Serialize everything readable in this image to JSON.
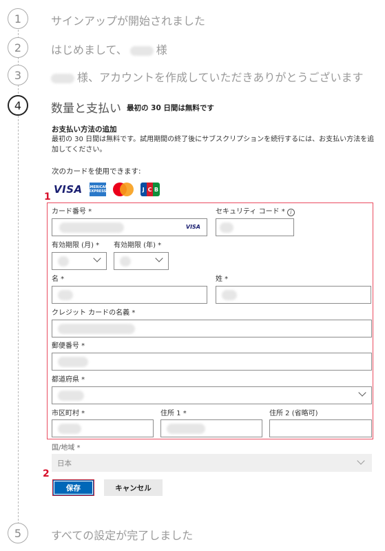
{
  "steps": [
    {
      "number": "1",
      "text": "サインアップが開始されました"
    },
    {
      "number": "2",
      "text_before": "はじめまして、",
      "text_after": "様"
    },
    {
      "number": "3",
      "text_after": "様、アカウントを作成していただきありがとうございます"
    },
    {
      "number": "4",
      "text": "数量と支払い",
      "subtitle": "最初の 30 日間は無料です"
    },
    {
      "number": "5",
      "text": "すべての設定が完了しました"
    }
  ],
  "payment": {
    "title": "お支払い方法の追加",
    "description": "最初の 30 日間は無料です。試用期間の終了後にサブスクリプションを続行するには、お支払い方法を追加してください。",
    "cards_label": "次のカードを使用できます:",
    "brands": {
      "visa": "VISA",
      "amex": "AMERICAN EXPRESS",
      "jcb_j": "J",
      "jcb_c": "C",
      "jcb_b": "B"
    }
  },
  "form": {
    "card_number_label": "カード番号 *",
    "card_brand_in_field": "VISA",
    "security_code_label": "セキュリティ コード *",
    "info_glyph": "i",
    "exp_month_label": "有効期限 (月) *",
    "exp_year_label": "有効期限 (年) *",
    "first_name_label": "名 *",
    "last_name_label": "姓 *",
    "cardholder_label": "クレジット カードの名義 *",
    "postal_label": "郵便番号 *",
    "prefecture_label": "都道府県 *",
    "city_label": "市区町村 *",
    "address1_label": "住所 1 *",
    "address2_label": "住所 2 (省略可)",
    "country_label": "国/地域 *",
    "country_value": "日本"
  },
  "buttons": {
    "save": "保存",
    "cancel": "キャンセル"
  },
  "annotations": {
    "form_marker": "1",
    "save_marker": "2"
  },
  "colors": {
    "primary": "#0067b8",
    "annotation_red": "#d7102b"
  }
}
